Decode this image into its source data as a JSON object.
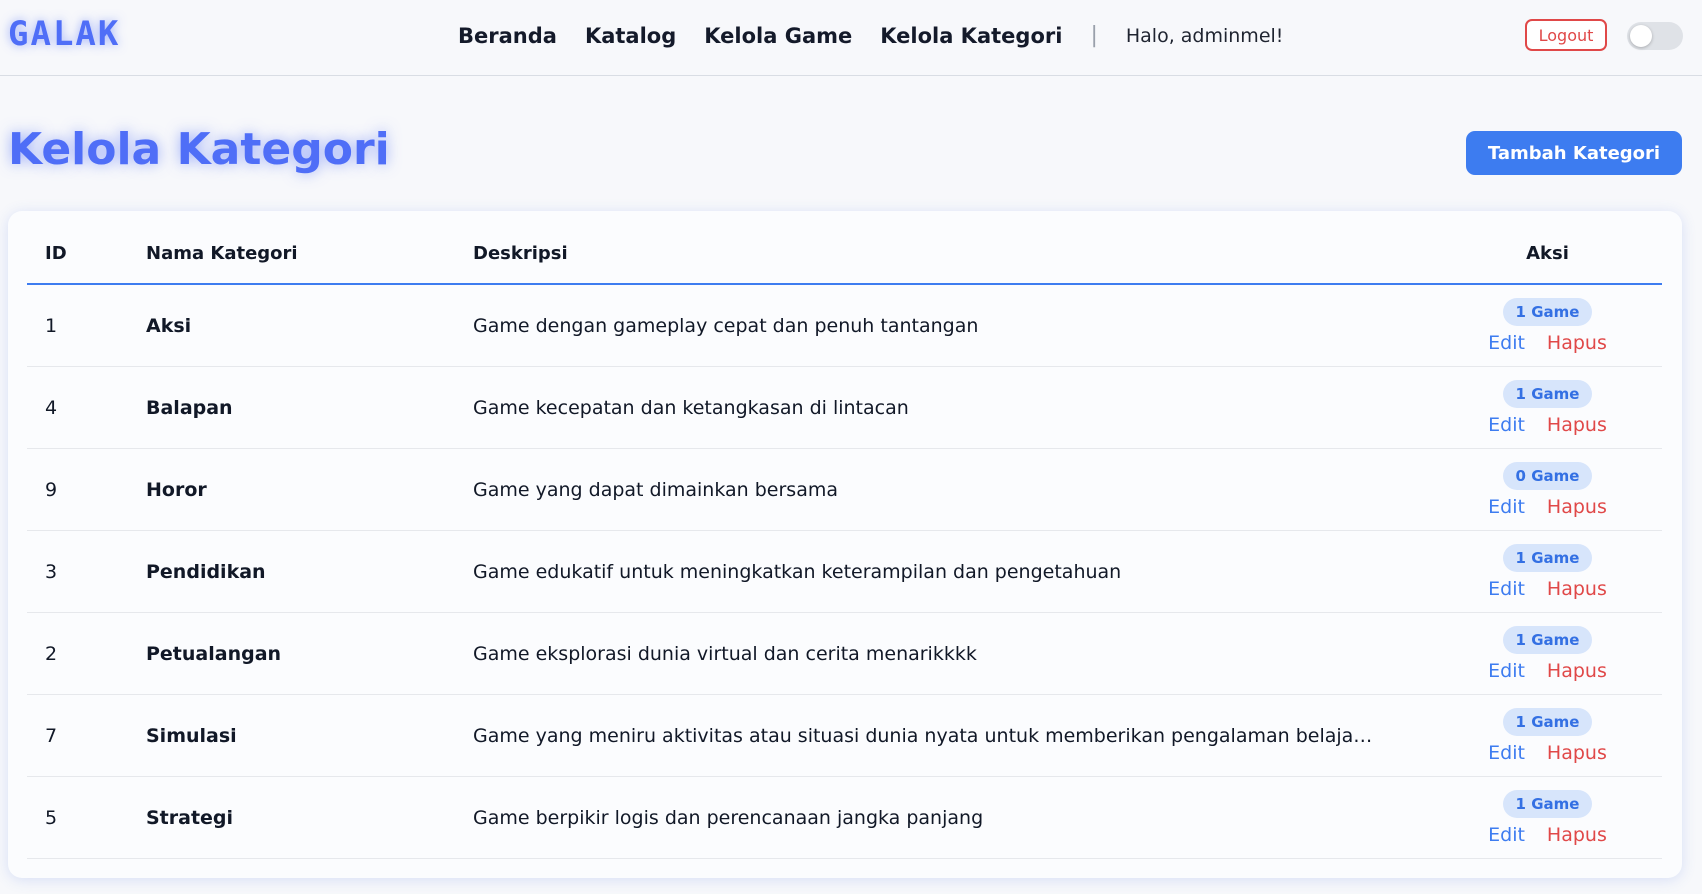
{
  "navbar": {
    "logo": "GALAK",
    "links": [
      "Beranda",
      "Katalog",
      "Kelola Game",
      "Kelola Kategori"
    ],
    "separator": "|",
    "greeting": "Halo, adminmel!",
    "logout": "Logout"
  },
  "page": {
    "title": "Kelola Kategori",
    "add_button": "Tambah Kategori"
  },
  "table": {
    "headers": [
      "ID",
      "Nama Kategori",
      "Deskripsi",
      "Aksi"
    ],
    "rows": [
      {
        "id": "1",
        "name": "Aksi",
        "desc": "Game dengan gameplay cepat dan penuh tantangan",
        "badge": "1 Game",
        "edit": "Edit",
        "delete": "Hapus"
      },
      {
        "id": "4",
        "name": "Balapan",
        "desc": "Game kecepatan dan ketangkasan di lintacan",
        "badge": "1 Game",
        "edit": "Edit",
        "delete": "Hapus"
      },
      {
        "id": "9",
        "name": "Horor",
        "desc": "Game yang dapat dimainkan bersama",
        "badge": "0 Game",
        "edit": "Edit",
        "delete": "Hapus"
      },
      {
        "id": "3",
        "name": "Pendidikan",
        "desc": "Game edukatif untuk meningkatkan keterampilan dan pengetahuan",
        "badge": "1 Game",
        "edit": "Edit",
        "delete": "Hapus"
      },
      {
        "id": "2",
        "name": "Petualangan",
        "desc": "Game eksplorasi dunia virtual dan cerita menarikkkk",
        "badge": "1 Game",
        "edit": "Edit",
        "delete": "Hapus"
      },
      {
        "id": "7",
        "name": "Simulasi",
        "desc": "Game yang meniru aktivitas atau situasi dunia nyata untuk memberikan pengalaman belajar, eks...",
        "badge": "1 Game",
        "edit": "Edit",
        "delete": "Hapus"
      },
      {
        "id": "5",
        "name": "Strategi",
        "desc": "Game berpikir logis dan perencanaan jangka panjang",
        "badge": "1 Game",
        "edit": "Edit",
        "delete": "Hapus"
      }
    ]
  },
  "colors": {
    "accent": "#3d7cf0",
    "brand": "#4f6ef7",
    "danger": "#e04848",
    "badge_bg": "#d7e5fb"
  }
}
